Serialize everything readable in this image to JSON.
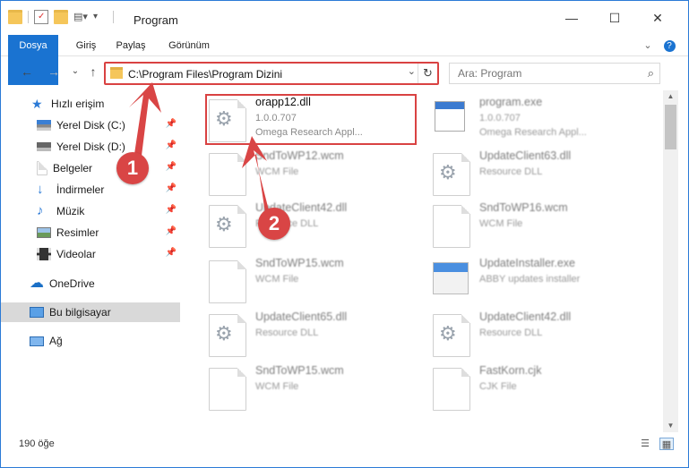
{
  "window": {
    "title": "Program",
    "minimize": "—",
    "maximize": "☐",
    "close": "✕"
  },
  "ribbon": {
    "tabs": [
      "Dosya",
      "Giriş",
      "Paylaş",
      "Görünüm"
    ],
    "expand": "⌄",
    "help": "?"
  },
  "nav": {
    "back": "←",
    "forward": "→",
    "recent": "⌄",
    "up": "↑"
  },
  "address": {
    "path": "C:\\Program Files\\Program Dizini",
    "dropdown": "⌄",
    "refresh": "↻"
  },
  "search": {
    "placeholder": "Ara: Program",
    "icon": "⌕"
  },
  "sidebar": {
    "items": [
      {
        "label": "Hızlı erişim",
        "icon": "star-icon"
      },
      {
        "label": "Yerel Disk (C:)",
        "icon": "drive-icon",
        "pinned": true
      },
      {
        "label": "Yerel Disk (D:)",
        "icon": "drive-icon",
        "pinned": true
      },
      {
        "label": "Belgeler",
        "icon": "document-icon",
        "pinned": true
      },
      {
        "label": "İndirmeler",
        "icon": "download-icon",
        "pinned": true
      },
      {
        "label": "Müzik",
        "icon": "music-icon",
        "pinned": true
      },
      {
        "label": "Resimler",
        "icon": "pictures-icon",
        "pinned": true
      },
      {
        "label": "Videolar",
        "icon": "video-icon",
        "pinned": true
      },
      {
        "label": "OneDrive",
        "icon": "cloud-icon"
      },
      {
        "label": "Bu bilgisayar",
        "icon": "computer-icon",
        "selected": true
      },
      {
        "label": "Ağ",
        "icon": "network-icon"
      }
    ],
    "pin_glyph": "📌"
  },
  "files": [
    {
      "name": "orapp12.dll",
      "line1": "1.0.0.707",
      "line2": "Omega Research Appl...",
      "type": "dll",
      "highlighted": true
    },
    {
      "name": "program.exe",
      "line1": "1.0.0.707",
      "line2": "Omega Research Appl...",
      "type": "exe"
    },
    {
      "name": "SndToWP12.wcm",
      "line1": "WCM File",
      "line2": "",
      "type": "page"
    },
    {
      "name": "UpdateClient63.dll",
      "line1": "Resource DLL",
      "line2": "",
      "type": "dll"
    },
    {
      "name": "UpdateClient42.dll",
      "line1": "Resource DLL",
      "line2": "",
      "type": "dll"
    },
    {
      "name": "SndToWP16.wcm",
      "line1": "WCM File",
      "line2": "",
      "type": "page"
    },
    {
      "name": "SndToWP15.wcm",
      "line1": "WCM File",
      "line2": "",
      "type": "page"
    },
    {
      "name": "UpdateInstaller.exe",
      "line1": "ABBY updates installer",
      "line2": "",
      "type": "win"
    },
    {
      "name": "UpdateClient65.dll",
      "line1": "Resource DLL",
      "line2": "",
      "type": "dll"
    },
    {
      "name": "UpdateClient42.dll",
      "line1": "Resource DLL",
      "line2": "",
      "type": "dll"
    },
    {
      "name": "SndToWP15.wcm",
      "line1": "WCM File",
      "line2": "",
      "type": "page"
    },
    {
      "name": "FastKorn.cjk",
      "line1": "CJK File",
      "line2": "",
      "type": "page"
    }
  ],
  "status": {
    "count": "190 öğe",
    "details_view": "☰",
    "large_view": "▦"
  },
  "annotations": {
    "marker1": "1",
    "marker2": "2"
  },
  "colors": {
    "accent": "#1a73d1",
    "highlight": "#d94242"
  }
}
